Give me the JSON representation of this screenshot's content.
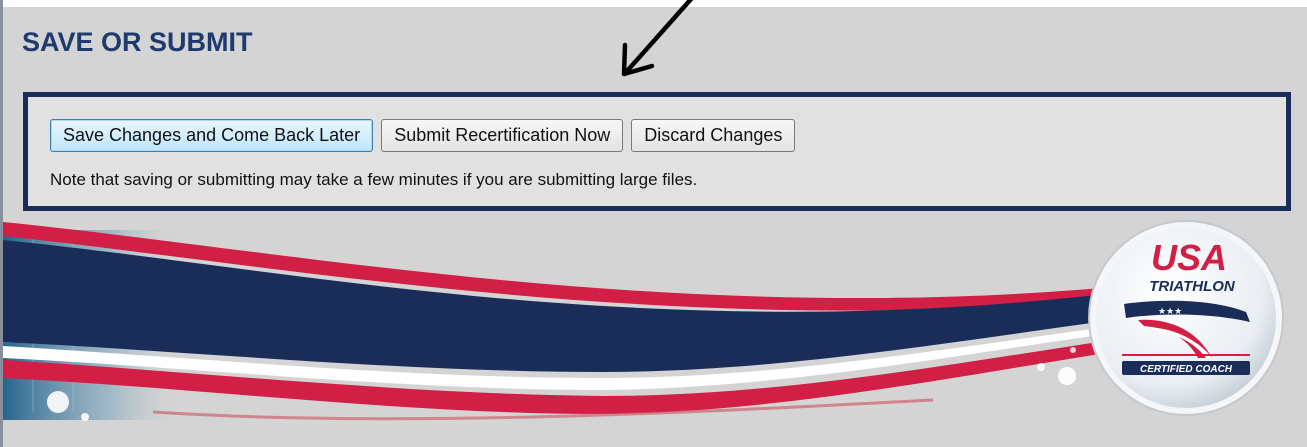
{
  "section": {
    "title": "SAVE OR SUBMIT"
  },
  "actions": {
    "save_label": "Save Changes and Come Back Later",
    "submit_label": "Submit Recertification Now",
    "discard_label": "Discard Changes"
  },
  "note": "Note that saving or submitting may take a few minutes if you are submitting large files.",
  "logo": {
    "line1": "USA",
    "line2": "TRIATHLON",
    "badge": "CERTIFIED COACH"
  },
  "colors": {
    "navy": "#1a2d58",
    "title_blue": "#1f3a6e",
    "red": "#d21f45",
    "background": "#d4d4d4"
  },
  "icons": [
    "annotation-arrow-icon",
    "usa-triathlon-logo"
  ]
}
